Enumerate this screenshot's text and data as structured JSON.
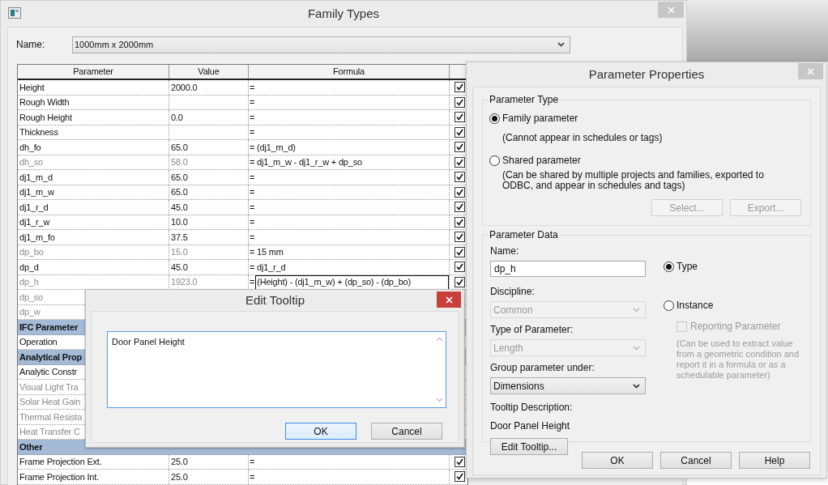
{
  "family_types": {
    "title": "Family Types",
    "name_label": "Name:",
    "name_value": "1000mm x 2000mm",
    "table": {
      "columns": [
        "Parameter",
        "Value",
        "Formula"
      ],
      "rows": [
        {
          "kind": "param",
          "parameter": "Height",
          "value": "2000.0",
          "formula": "=",
          "dimmed": false,
          "checked": true
        },
        {
          "kind": "param",
          "parameter": "Rough Width",
          "formula": "=",
          "dimmed": false,
          "checked": true
        },
        {
          "kind": "param",
          "parameter": "Rough Height",
          "value": "0.0",
          "formula": "=",
          "dimmed": false,
          "checked": true
        },
        {
          "kind": "param",
          "parameter": "Thickness",
          "formula": "=",
          "dimmed": false,
          "checked": true
        },
        {
          "kind": "param",
          "parameter": "dh_fo",
          "value": "65.0",
          "formula": "= (dj1_m_d)",
          "dimmed": false,
          "checked": true
        },
        {
          "kind": "param",
          "parameter": "dh_so",
          "value": "58.0",
          "formula": "= dj1_m_w - dj1_r_w + dp_so",
          "dimmed": true,
          "checked": true
        },
        {
          "kind": "param",
          "parameter": "dj1_m_d",
          "value": "65.0",
          "formula": "=",
          "dimmed": false,
          "checked": true
        },
        {
          "kind": "param",
          "parameter": "dj1_m_w",
          "value": "65.0",
          "formula": "=",
          "dimmed": false,
          "checked": true
        },
        {
          "kind": "param",
          "parameter": "dj1_r_d",
          "value": "45.0",
          "formula": "=",
          "dimmed": false,
          "checked": true
        },
        {
          "kind": "param",
          "parameter": "dj1_r_w",
          "value": "10.0",
          "formula": "=",
          "dimmed": false,
          "checked": true
        },
        {
          "kind": "param",
          "parameter": "dj1_m_fo",
          "value": "37.5",
          "formula": "=",
          "dimmed": false,
          "checked": true
        },
        {
          "kind": "param",
          "parameter": "dp_bo",
          "value": "15.0",
          "formula": "= 15 mm",
          "dimmed": true,
          "checked": true
        },
        {
          "kind": "param",
          "parameter": "dp_d",
          "value": "45.0",
          "formula": "= dj1_r_d",
          "dimmed": false,
          "checked": true
        },
        {
          "kind": "param",
          "parameter": "dp_h",
          "value": "1923.0",
          "formula": "=",
          "formula_edit": "(Height) - (dj1_m_w) + (dp_so) - (dp_bo)",
          "dimmed": true,
          "checked": true
        },
        {
          "kind": "param",
          "parameter": "dp_so",
          "dimmed": true
        },
        {
          "kind": "param",
          "parameter": "dp_w",
          "dimmed": true
        },
        {
          "kind": "group",
          "parameter": "IFC Parameter"
        },
        {
          "kind": "param",
          "parameter": "Operation",
          "dimmed": false
        },
        {
          "kind": "group",
          "parameter": "Analytical Prop"
        },
        {
          "kind": "param",
          "parameter": "Analytic Constr",
          "dimmed": false
        },
        {
          "kind": "param",
          "parameter": "Visual Light Tra",
          "dimmed": true
        },
        {
          "kind": "param",
          "parameter": "Solar Heat Gain",
          "dimmed": true
        },
        {
          "kind": "param",
          "parameter": "Thermal Resista",
          "dimmed": true
        },
        {
          "kind": "param",
          "parameter": "Heat Transfer C",
          "dimmed": true
        },
        {
          "kind": "group",
          "parameter": "Other"
        },
        {
          "kind": "param",
          "parameter": "Frame Projection Ext.",
          "value": "25.0",
          "formula": "=",
          "dimmed": false,
          "checked": true
        },
        {
          "kind": "param",
          "parameter": "Frame Projection Int.",
          "value": "25.0",
          "formula": "=",
          "dimmed": false,
          "checked": true
        }
      ]
    }
  },
  "edit_tooltip": {
    "title": "Edit Tooltip",
    "text": "Door Panel Height",
    "buttons": [
      {
        "label": "OK",
        "default": true
      },
      {
        "label": "Cancel",
        "default": false
      }
    ]
  },
  "parameter_properties": {
    "title": "Parameter Properties",
    "type_group": {
      "legend": "Parameter Type",
      "options": [
        {
          "label": "Family parameter",
          "note": "(Cannot appear in schedules or tags)",
          "selected": true
        },
        {
          "label": "Shared parameter",
          "note": "(Can be shared by multiple projects and families, exported to ODBC, and appear in schedules and tags)",
          "selected": false
        }
      ],
      "buttons": [
        {
          "label": "Select...",
          "disabled": true
        },
        {
          "label": "Export...",
          "disabled": true
        }
      ]
    },
    "data_group": {
      "legend": "Parameter Data",
      "name_label": "Name:",
      "name_value": "dp_h",
      "discipline_label": "Discipline:",
      "discipline": {
        "value": "Common",
        "disabled": true
      },
      "type_label": "Type of Parameter:",
      "type": {
        "value": "Length",
        "disabled": true
      },
      "group_label": "Group parameter under:",
      "group": {
        "value": "Dimensions",
        "disabled": false
      },
      "tooltip_label": "Tooltip Description:",
      "tooltip": "Door Panel Height",
      "edit_tooltip_button": "Edit Tooltip...",
      "scope": [
        {
          "label": "Type",
          "selected": true
        },
        {
          "label": "Instance",
          "selected": false
        }
      ],
      "reporting": {
        "label": "Reporting Parameter",
        "checked": false,
        "disabled": true
      },
      "reporting_note": "(Can be used to extract value from a geometric condition and report it in a formula or as a schedulable parameter)"
    },
    "buttons": [
      "OK",
      "Cancel",
      "Help"
    ]
  }
}
